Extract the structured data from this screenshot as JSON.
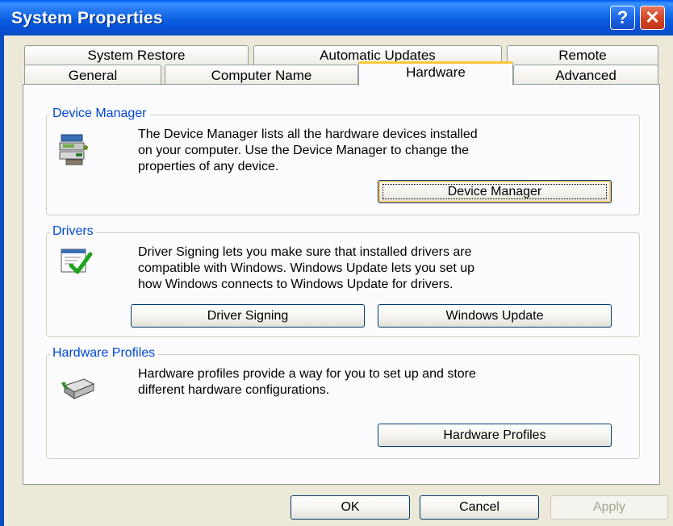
{
  "window": {
    "title": "System Properties",
    "help_button": "?",
    "close_button": "✕"
  },
  "tabs": {
    "row1": [
      "System Restore",
      "Automatic Updates",
      "Remote"
    ],
    "row2": [
      "General",
      "Computer Name",
      "Hardware",
      "Advanced"
    ],
    "active": "Hardware"
  },
  "device_manager": {
    "title": "Device Manager",
    "line1": "The Device Manager lists all the hardware devices installed",
    "line2": "on your computer. Use the Device Manager to change the",
    "line3": "properties of any device.",
    "button_label": "Device Manager",
    "icon": "device-manager-icon"
  },
  "drivers": {
    "title": "Drivers",
    "line1": "Driver Signing lets you make sure that installed drivers are",
    "line2": "compatible with Windows. Windows Update lets you set up",
    "line3": "how Windows connects to Windows Update for drivers.",
    "signing_button": "Driver Signing",
    "update_button": "Windows Update",
    "icon": "driver-signing-icon"
  },
  "hardware_profiles": {
    "title": "Hardware Profiles",
    "line1": "Hardware profiles provide a way for you to set up and store",
    "line2": "different hardware configurations.",
    "button_label": "Hardware Profiles",
    "icon": "hardware-profiles-icon"
  },
  "footer": {
    "ok": "OK",
    "cancel": "Cancel",
    "apply": "Apply"
  },
  "colors": {
    "titlebar": "#0A5FE0",
    "group_title": "#0046D5",
    "active_tab_accent": "#FFC83C",
    "dialog_background": "#ECE9D8"
  }
}
